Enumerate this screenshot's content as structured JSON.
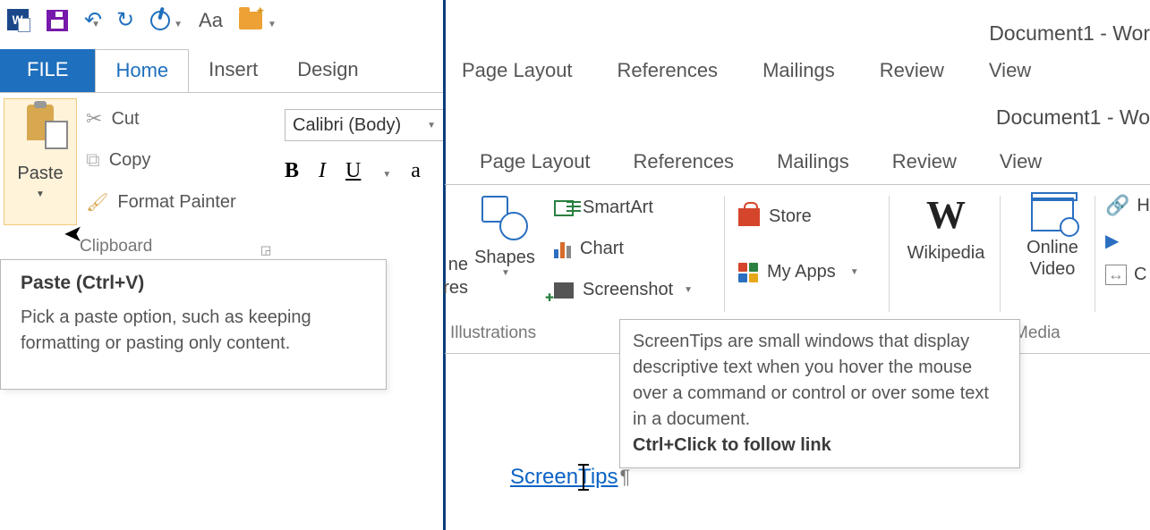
{
  "title1": "Document1 - Wor",
  "title2": "Document1 - Wo",
  "qat": {
    "aa": "Aa"
  },
  "tabs1": {
    "file": "FILE",
    "home": "Home",
    "insert": "Insert",
    "design": "Design"
  },
  "paste": {
    "label": "Paste",
    "cut": "Cut",
    "copy": "Copy",
    "format_painter": "Format Painter",
    "group": "Clipboard"
  },
  "font": {
    "name": "Calibri (Body)",
    "b": "B",
    "i": "I",
    "u": "U",
    "a": "a"
  },
  "tooltip_paste": {
    "title": "Paste (Ctrl+V)",
    "body": "Pick a paste option, such as keeping formatting or pasting only content."
  },
  "tabs2a": {
    "page_layout": "Page Layout",
    "references": "References",
    "mailings": "Mailings",
    "review": "Review",
    "view": "View"
  },
  "tabs2b": {
    "page_layout": "Page Layout",
    "references": "References",
    "mailings": "Mailings",
    "review": "Review",
    "view": "View"
  },
  "ribbon2": {
    "res_partial": "ne\nres",
    "shapes": "Shapes",
    "smartart": "SmartArt",
    "chart": "Chart",
    "screenshot": "Screenshot",
    "store": "Store",
    "myapps": "My Apps",
    "wikipedia": "Wikipedia",
    "online_video": "Online\nVideo",
    "hyper_partial": "H",
    "cross_partial": "C",
    "group_illustrations": "Illustrations",
    "group_media": "Media"
  },
  "tooltip_link": {
    "body": "ScreenTips are small windows that display descriptive text when you hover the mouse over a command or control or over some text in a document.",
    "cta": "Ctrl+Click to follow link"
  },
  "doc": {
    "hyperlink_text": "ScreenTips",
    "pilcrow": "¶"
  }
}
